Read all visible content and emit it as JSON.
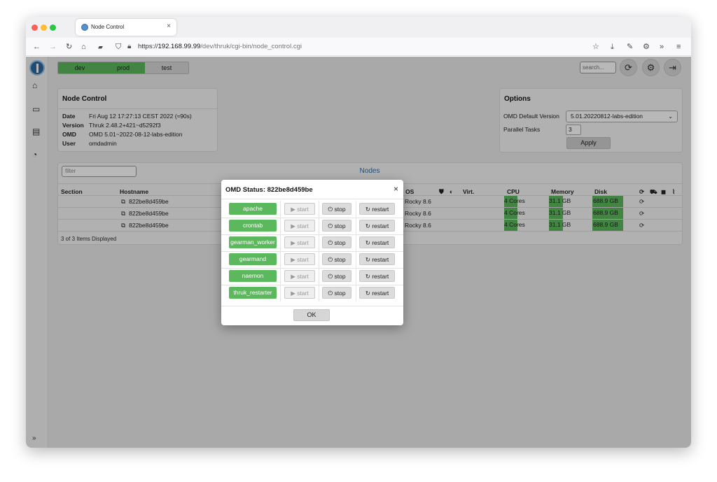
{
  "browser": {
    "tab_title": "Node Control",
    "tab_close": "×",
    "url_scheme": "https://",
    "url_host": "192.168.99.99",
    "url_path": "/dev/thruk/cgi-bin/node_control.cgi"
  },
  "topbar": {
    "envs": [
      "dev",
      "prod",
      "test"
    ],
    "search_placeholder": "search..."
  },
  "node_control": {
    "title": "Node Control",
    "rows": [
      {
        "k": "Date",
        "v": "Fri Aug 12 17:27:13 CEST 2022 (≈90s)"
      },
      {
        "k": "Version",
        "v": "Thruk 2.48.2+421~d5292f3"
      },
      {
        "k": "OMD",
        "v": "OMD 5.01~2022-08-12-labs-edition"
      },
      {
        "k": "User",
        "v": "omdadmin"
      }
    ]
  },
  "options": {
    "title": "Options",
    "default_version_label": "OMD Default Version",
    "default_version_value": "5.01.20220812-labs-edition",
    "parallel_label": "Parallel Tasks",
    "parallel_value": "3",
    "apply_label": "Apply"
  },
  "nodes": {
    "filter_placeholder": "filter",
    "tab_label": "Nodes",
    "headers": {
      "section": "Section",
      "hostname": "Hostname",
      "os": "OS",
      "virt": "Virt.",
      "cpu": "CPU",
      "memory": "Memory",
      "disk": "Disk"
    },
    "rows": [
      {
        "hostname": "822be8d459be",
        "os": "Rocky 8.6",
        "cpu": "4 Cores",
        "memory": "31.1 GB",
        "disk": "688.9 GB"
      },
      {
        "hostname": "822be8d459be",
        "os": "Rocky 8.6",
        "cpu": "4 Cores",
        "memory": "31.1 GB",
        "disk": "688.9 GB"
      },
      {
        "hostname": "822be8d459be",
        "os": "Rocky 8.6",
        "cpu": "4 Cores",
        "memory": "31.1 GB",
        "disk": "688.9 GB"
      }
    ],
    "footer": "3 of 3 Items Displayed"
  },
  "modal": {
    "title": "OMD Status: 822be8d459be",
    "services": [
      "apache",
      "crontab",
      "gearman_worker",
      "gearmand",
      "naemon",
      "thruk_restarter"
    ],
    "start_label": "start",
    "stop_label": "stop",
    "restart_label": "restart",
    "ok_label": "OK"
  },
  "colors": {
    "accent_green": "#5cb85c",
    "link_blue": "#2a6fb3"
  }
}
